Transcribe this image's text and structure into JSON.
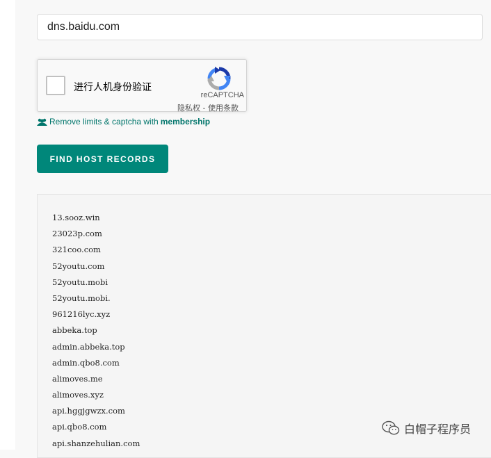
{
  "search": {
    "value": "dns.baidu.com"
  },
  "captcha": {
    "label": "进行人机身份验证",
    "brand": "reCAPTCHA",
    "privacy_link": "隐私权",
    "separator": " - ",
    "terms_link": "使用条款"
  },
  "membership": {
    "text": "Remove limits & captcha with",
    "link": "membership"
  },
  "find_button": {
    "label": "FIND HOST RECORDS"
  },
  "results": [
    "13.sooz.win",
    "23023p.com",
    "321coo.com",
    "52youtu.com",
    "52youtu.mobi",
    "52youtu.mobi.",
    "961216lyc.xyz",
    "abbeka.top",
    "admin.abbeka.top",
    "admin.qbo8.com",
    "alimoves.me",
    "alimoves.xyz",
    "api.hggjgwzx.com",
    "api.qbo8.com",
    "api.shanzehulian.com"
  ],
  "watermark": {
    "text": "白帽子程序员",
    "icon": "wechat-icon"
  },
  "colors": {
    "accent": "#00877a",
    "link": "#00756b",
    "background": "#f8f8f8"
  }
}
